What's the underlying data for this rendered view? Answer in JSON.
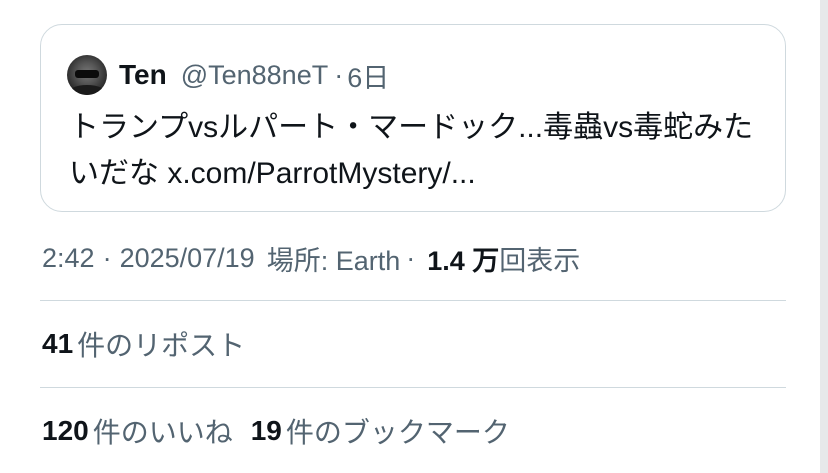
{
  "quoted_post": {
    "author_name": "Ten",
    "author_handle": "@Ten88neT",
    "separator": "·",
    "time": "6日",
    "text_line_1": "トランプvsルパート・マードック...毒蟲vs毒蛇みた",
    "text_line_2": "いだな x.com/ParrotMystery/..."
  },
  "meta": {
    "time": "2:42",
    "separator_1": "·",
    "date": "2025/07/19",
    "location": "場所: Earth",
    "separator_2": "·",
    "views_count": "1.4 万",
    "views_label": "回表示"
  },
  "stats": {
    "reposts_count": "41",
    "reposts_label": "件のリポスト",
    "likes_count": "120",
    "likes_label": "件のいいね",
    "bookmarks_count": "19",
    "bookmarks_label": "件のブックマーク"
  },
  "icons": {
    "avatar": "user-avatar"
  }
}
